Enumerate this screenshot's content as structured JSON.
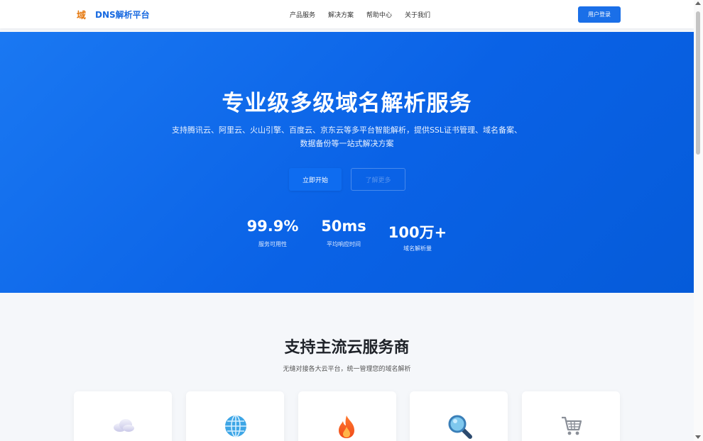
{
  "header": {
    "logo_mark": "域",
    "logo_text": "DNS解析平台",
    "nav": [
      {
        "label": "产品服务"
      },
      {
        "label": "解决方案"
      },
      {
        "label": "帮助中心"
      },
      {
        "label": "关于我们"
      }
    ],
    "login_label": "用户登录"
  },
  "hero": {
    "title": "专业级多级域名解析服务",
    "subtitle_line1": "支持腾讯云、阿里云、火山引擎、百度云、京东云等多平台智能解析，提供SSL证书管理、域名备案、",
    "subtitle_line2": "数据备份等一站式解决方案",
    "start_label": "立即开始",
    "learn_label": "了解更多",
    "stats": [
      {
        "value": "99.9%",
        "label": "服务可用性"
      },
      {
        "value": "50ms",
        "label": "平均响应时间"
      },
      {
        "value": "100万+",
        "label": "域名解析量"
      }
    ]
  },
  "providers": {
    "title": "支持主流云服务商",
    "subtitle": "无缝对接各大云平台，统一管理您的域名解析",
    "cards": [
      {
        "icon": "cloud-icon"
      },
      {
        "icon": "globe-icon"
      },
      {
        "icon": "fire-icon"
      },
      {
        "icon": "magnifier-icon"
      },
      {
        "icon": "shopping-cart-icon"
      }
    ]
  },
  "colors": {
    "brand": "#1a6fe8",
    "logo_orange": "#e5780e",
    "hero_gradient_start": "#1a78f2",
    "hero_gradient_end": "#055bd9"
  }
}
